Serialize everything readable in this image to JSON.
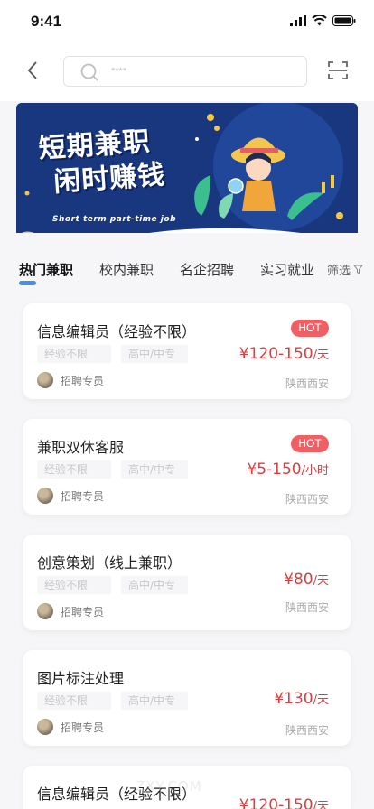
{
  "status": {
    "time": "9:41"
  },
  "search": {
    "placeholder": "****"
  },
  "banner": {
    "title_line1": "短期兼职",
    "title_line2": "闲时赚钱",
    "subtitle": "Short term part-time job"
  },
  "tabs": [
    {
      "label": "热门兼职",
      "active": true
    },
    {
      "label": "校内兼职",
      "active": false
    },
    {
      "label": "名企招聘",
      "active": false
    },
    {
      "label": "实习就业",
      "active": false
    }
  ],
  "filter_label": "筛选",
  "jobs": [
    {
      "title": "信息编辑员（经验不限）",
      "tag1": "经验不限",
      "tag2": "高中/中专",
      "recruiter": "招聘专员",
      "hot": "HOT",
      "salary": "¥120-150",
      "unit": "/天",
      "location": "陕西西安"
    },
    {
      "title": "兼职双休客服",
      "tag1": "经验不限",
      "tag2": "高中/中专",
      "recruiter": "招聘专员",
      "hot": "HOT",
      "salary": "¥5-150",
      "unit": "/小时",
      "location": "陕西西安"
    },
    {
      "title": "创意策划（线上兼职）",
      "tag1": "经验不限",
      "tag2": "高中/中专",
      "recruiter": "招聘专员",
      "salary": "¥80",
      "unit": "/天",
      "location": "陕西西安"
    },
    {
      "title": "图片标注处理",
      "tag1": "经验不限",
      "tag2": "高中/中专",
      "recruiter": "招聘专员",
      "salary": "¥130",
      "unit": "/天",
      "location": "陕西西安"
    },
    {
      "title": "信息编辑员（经验不限）",
      "salary": "¥120-150",
      "unit": "/天"
    }
  ],
  "watermark": "ZXY.COM",
  "colors": {
    "accent": "#4a90e2",
    "price": "#dc3d3f",
    "hot": "#ef5f63",
    "banner": "#19377f"
  }
}
